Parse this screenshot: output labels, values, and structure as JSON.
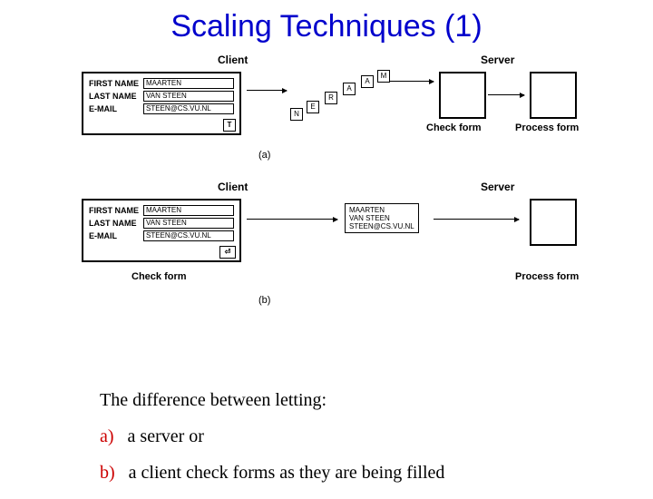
{
  "title": "Scaling Techniques (1)",
  "labels": {
    "client": "Client",
    "server": "Server",
    "check_form": "Check form",
    "process_form": "Process form",
    "first_name": "FIRST NAME",
    "last_name": "LAST NAME",
    "email": "E-MAIL",
    "sub_a": "(a)",
    "sub_b": "(b)"
  },
  "values": {
    "first_name": "MAARTEN",
    "last_name": "VAN STEEN",
    "email": "STEEN@CS.VU.NL"
  },
  "packet": {
    "line1": "MAARTEN",
    "line2": "VAN STEEN",
    "line3": "STEEN@CS.VU.NL"
  },
  "letters": {
    "M": "M",
    "A": "A",
    "R": "R",
    "E": "E",
    "N": "N",
    "T": "T"
  },
  "caption": {
    "intro": "The difference between letting:",
    "a_prefix": "a)",
    "a_text": "a server or",
    "b_prefix": "b)",
    "b_text": "a client check forms as they are being filled"
  }
}
